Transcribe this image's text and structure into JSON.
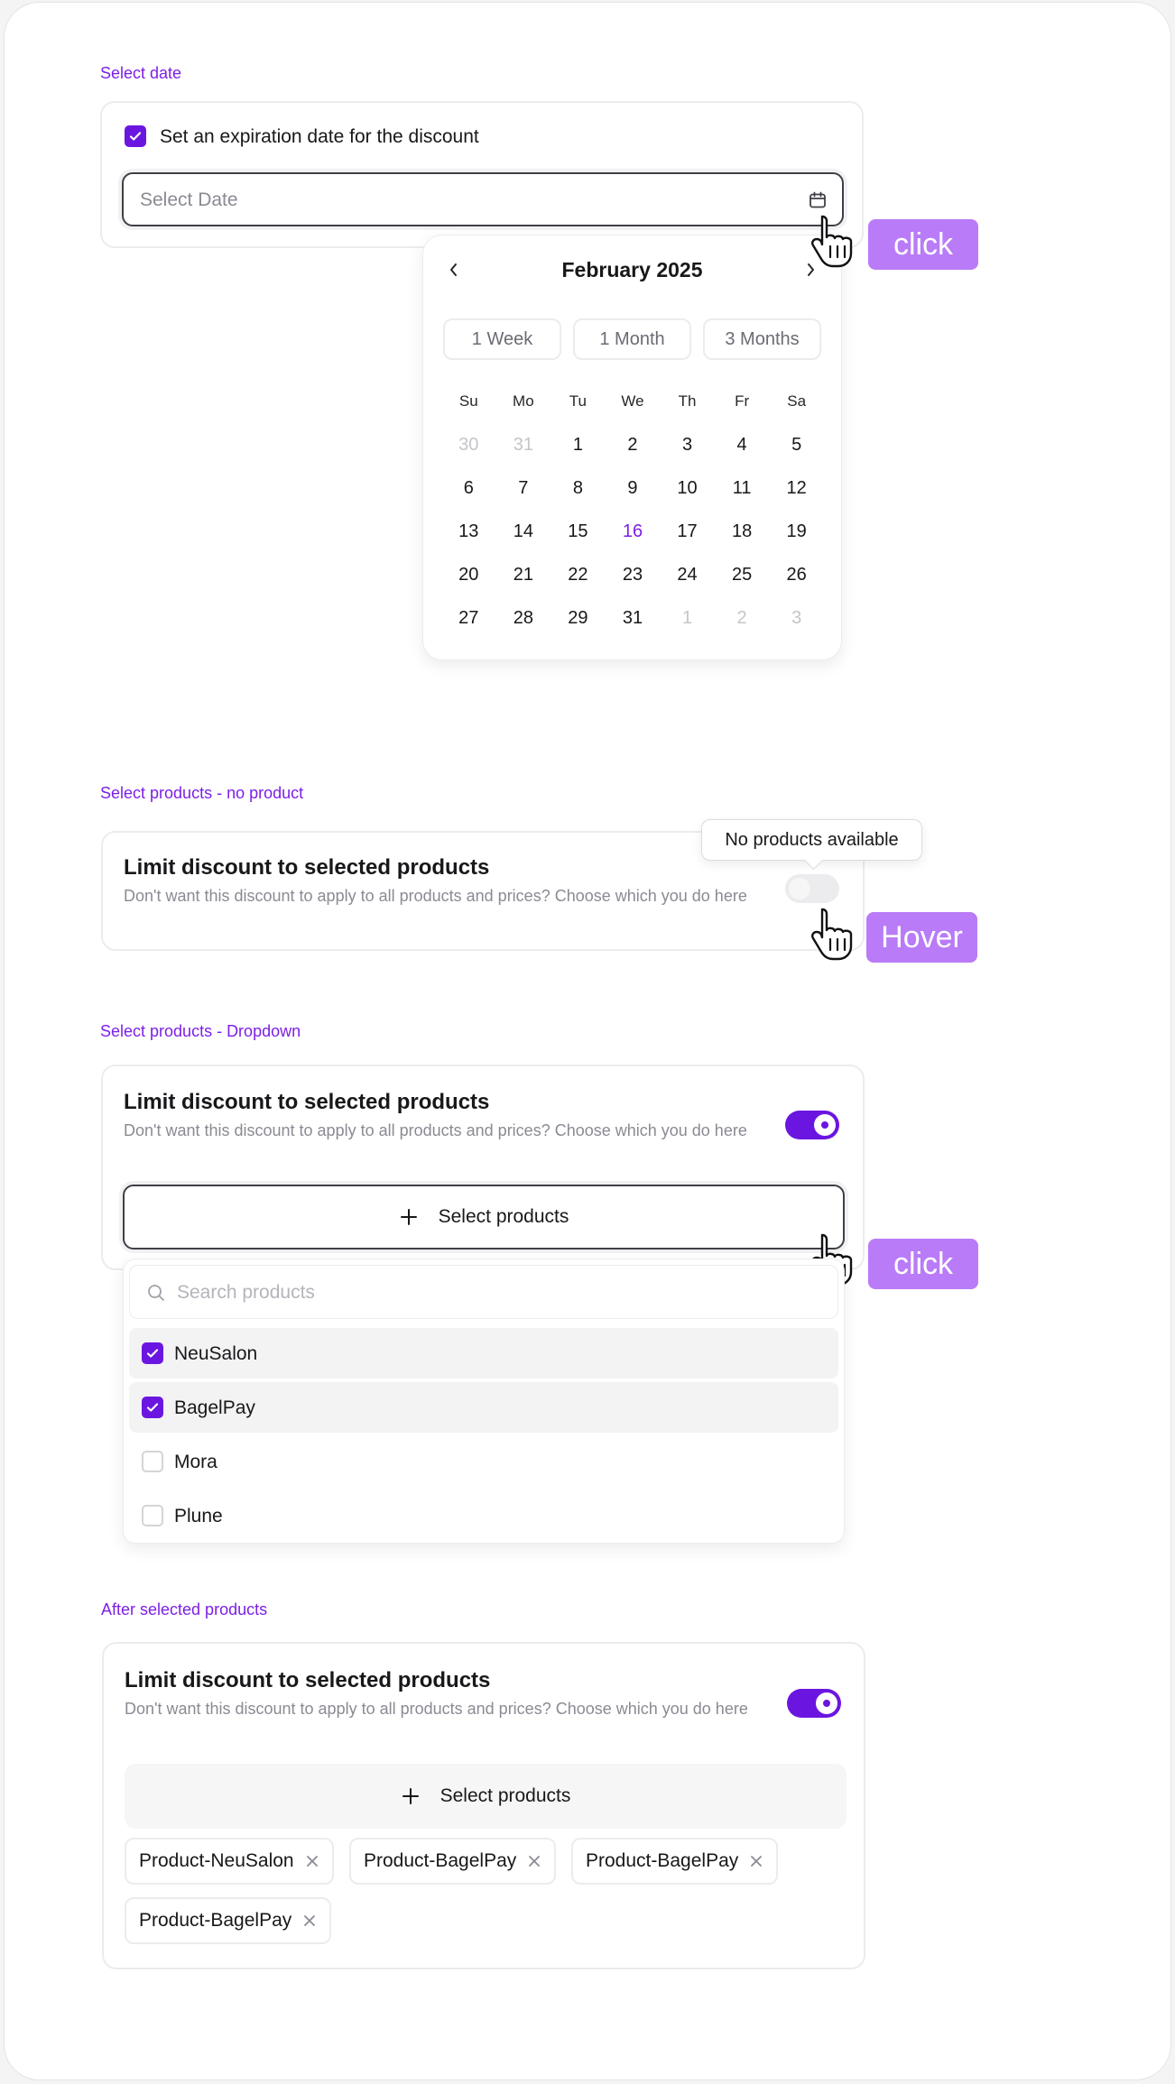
{
  "sections": {
    "date": "Select date",
    "no_product": "Select products - no product",
    "dropdown": "Select products - Dropdown",
    "after": "After selected products"
  },
  "date_card": {
    "checkbox_label": "Set an expiration date for the discount",
    "checked": true,
    "placeholder": "Select Date"
  },
  "calendar": {
    "month": "February 2025",
    "quick": [
      "1 Week",
      "1 Month",
      "3 Months"
    ],
    "days_of_week": [
      "Su",
      "Mo",
      "Tu",
      "We",
      "Th",
      "Fr",
      "Sa"
    ],
    "weeks": [
      [
        "30",
        "31",
        "1",
        "2",
        "3",
        "4",
        "5"
      ],
      [
        "6",
        "7",
        "8",
        "9",
        "10",
        "11",
        "12"
      ],
      [
        "13",
        "14",
        "15",
        "16",
        "17",
        "18",
        "19"
      ],
      [
        "20",
        "21",
        "22",
        "23",
        "24",
        "25",
        "26"
      ],
      [
        "27",
        "28",
        "29",
        "31",
        "1",
        "2",
        "3"
      ]
    ],
    "today": "16"
  },
  "limit": {
    "title": "Limit discount to selected products",
    "desc": "Don't want this discount to apply to all products and prices? Choose which you do here",
    "select_label": "Select products"
  },
  "tooltip": "No products available",
  "badges": {
    "click": "click",
    "hover": "Hover"
  },
  "dropdown": {
    "search_placeholder": "Search products",
    "options": [
      {
        "label": "NeuSalon",
        "checked": true
      },
      {
        "label": "BagelPay",
        "checked": true
      },
      {
        "label": "Mora",
        "checked": false
      },
      {
        "label": "Plune",
        "checked": false
      }
    ]
  },
  "chips": [
    "Product-NeuSalon",
    "Product-BagelPay",
    "Product-BagelPay",
    "Product-BagelPay"
  ],
  "colors": {
    "accent": "#6b16e0",
    "label": "#7c1fe6",
    "badge": "#b97bf7"
  }
}
